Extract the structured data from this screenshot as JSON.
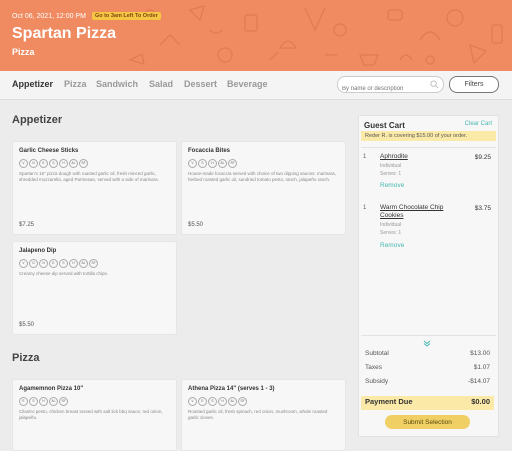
{
  "header": {
    "date": "Oct 06, 2021, 12:00 PM",
    "badge": "Go to 3am Left To Order",
    "restaurant": "Spartan Pizza",
    "category": "Pizza"
  },
  "nav": {
    "tabs": [
      "Appetizer",
      "Pizza",
      "Sandwich",
      "Salad",
      "Dessert",
      "Beverage"
    ],
    "active": "Appetizer",
    "search_placeholder": "By name or description",
    "filters_label": "Filters"
  },
  "sections": [
    {
      "title": "Appetizer",
      "items": [
        {
          "name": "Garlic Cheese Sticks",
          "tags": [
            "V",
            "N",
            "E",
            "S",
            "H",
            "AL",
            "SF"
          ],
          "description": "Spartan's 16\" pizza dough with roasted garlic oil, fresh minced garlic, shredded mozzarella, aged Parmesan, served with a side of marinara.",
          "price": "$7.25"
        },
        {
          "name": "Focaccia Bites",
          "tags": [
            "V",
            "S",
            "H",
            "AL",
            "SF"
          ],
          "description": "House-made focaccia served with choice of two dipping sauces: marinara, herbed roasted garlic oil, sundried tomato pesto, ranch, jalapeño ranch.",
          "price": "$5.50"
        },
        {
          "name": "Jalapeno Dip",
          "tags": [
            "V",
            "G",
            "N",
            "E",
            "S",
            "H",
            "AL",
            "SF"
          ],
          "description": "Creamy cheese dip served with tortilla chips.",
          "price": "$5.50"
        }
      ]
    },
    {
      "title": "Pizza",
      "items": [
        {
          "name": "Agamemnon Pizza 10\"",
          "tags": [
            "E",
            "S",
            "H",
            "AL",
            "SF"
          ],
          "description": "Cilantro pesto, chicken breast tossed with salt lick bbq sauce, red onion, jalapeño."
        },
        {
          "name": "Athena Pizza 14\" (serves 1 - 3)",
          "tags": [
            "V",
            "E",
            "S",
            "H",
            "AL",
            "SF"
          ],
          "description": "Roasted garlic oil, fresh spinach, red onion, mushroom, whole roasted garlic cloves."
        }
      ]
    }
  ],
  "cart": {
    "title": "Guest Cart",
    "clear_label": "Clear Cart",
    "coverage_note": "Reder R. is covering $15.00 of your order.",
    "items": [
      {
        "qty": "1",
        "name": "Aphrodite",
        "type": "Individual",
        "serves": "Serves: 1",
        "price": "$9.25",
        "remove_label": "Remove"
      },
      {
        "qty": "1",
        "name": "Warm Chocolate Chip Cookies",
        "type": "Individual",
        "serves": "Serves: 1",
        "price": "$3.75",
        "remove_label": "Remove"
      }
    ],
    "summary": {
      "subtotal_label": "Subtotal",
      "subtotal": "$13.00",
      "taxes_label": "Taxes",
      "taxes": "$1.07",
      "subsidy_label": "Subsidy",
      "subsidy": "-$14.07"
    },
    "payment_label": "Payment Due",
    "payment_due": "$0.00",
    "submit_label": "Submit Selection"
  },
  "colors": {
    "hero": "#ef8a61",
    "badge": "#f6c544",
    "accent": "#45b8b0",
    "highlight": "#fbe9a8",
    "submit": "#f0d064"
  },
  "icons": [
    "food-pattern-icons",
    "search-icon",
    "chevron-down-icon"
  ]
}
